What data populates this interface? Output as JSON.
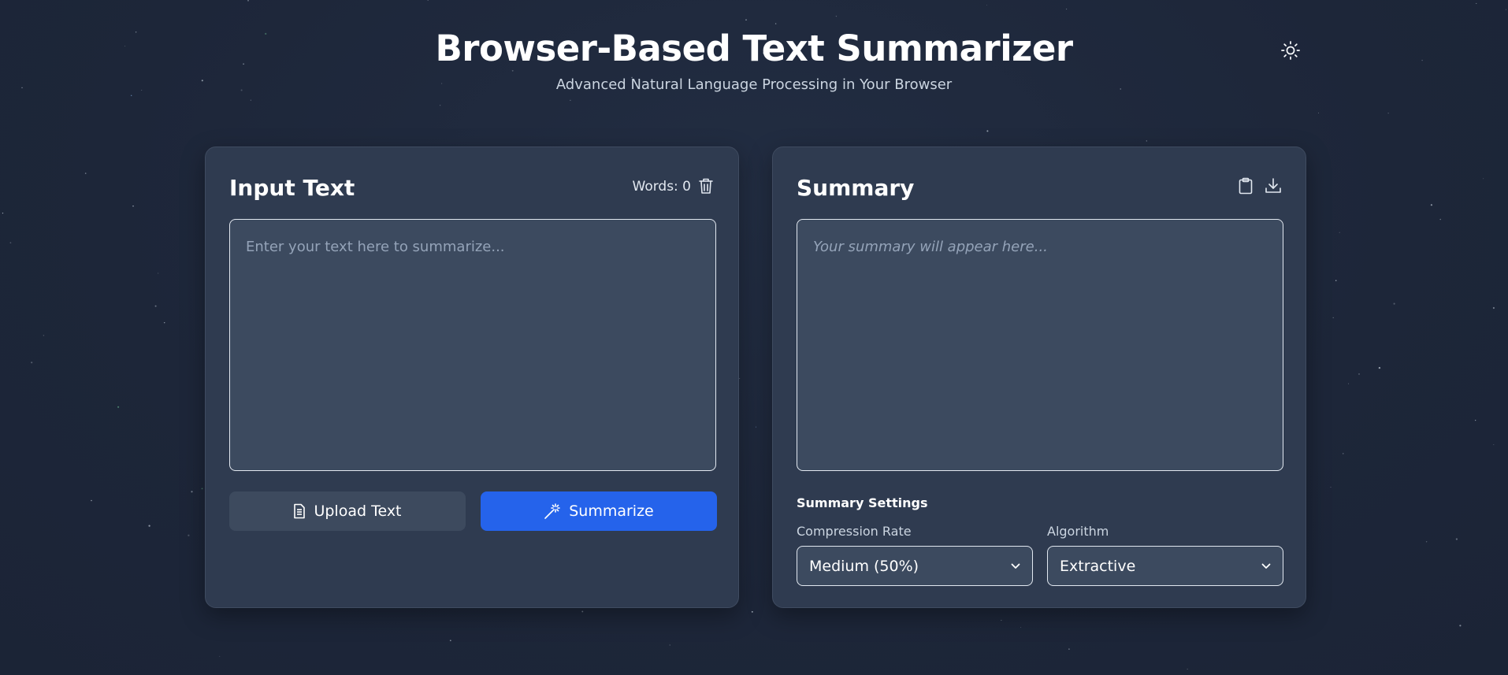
{
  "header": {
    "title": "Browser-Based Text Summarizer",
    "subtitle": "Advanced Natural Language Processing in Your Browser",
    "theme_toggle_icon": "sun-icon"
  },
  "input_panel": {
    "title": "Input Text",
    "word_count": "Words: 0",
    "clear_icon": "trash-icon",
    "textarea": {
      "value": "",
      "placeholder": "Enter your text here to summarize..."
    },
    "upload_button": {
      "label": "Upload Text",
      "icon": "document-icon"
    },
    "summarize_button": {
      "label": "Summarize",
      "icon": "magic-wand-icon"
    }
  },
  "summary_panel": {
    "title": "Summary",
    "copy_icon": "clipboard-icon",
    "download_icon": "download-icon",
    "placeholder": "Your summary will appear here...",
    "settings": {
      "title": "Summary Settings",
      "compression": {
        "label": "Compression Rate",
        "value": "Medium (50%)"
      },
      "algorithm": {
        "label": "Algorithm",
        "value": "Extractive"
      }
    }
  },
  "colors": {
    "background": "#1e293b",
    "card": "#2f3b50",
    "field": "#3c4a5f",
    "accent": "#2563eb",
    "secondary_button": "#3d4a5e"
  }
}
